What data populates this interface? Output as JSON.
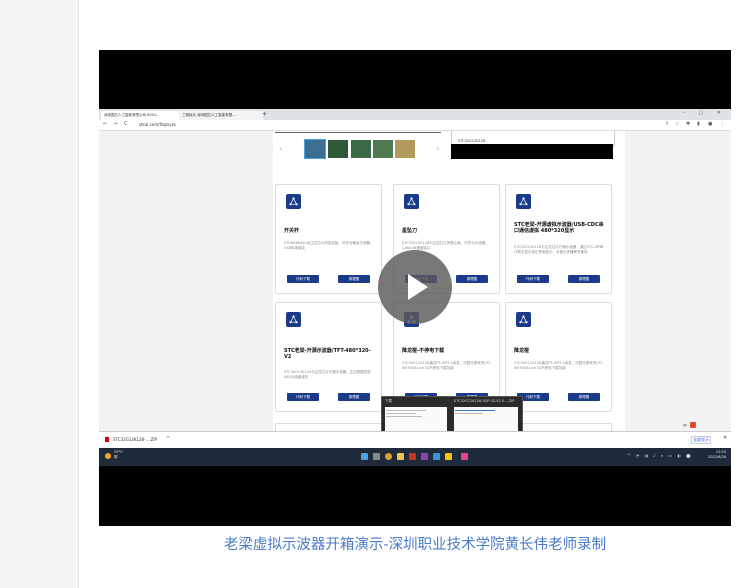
{
  "browser": {
    "tabs": [
      {
        "label": "深圳国芯人工智能有限公司-8051..."
      },
      {
        "label": "三相硅片-深圳国芯人工智能有限..."
      }
    ],
    "new_tab": "+",
    "window_controls": "–  ▢  ✕",
    "address": "stcai.com/fzq/xyzs",
    "nav_back": "←",
    "nav_forward": "→",
    "nav_reload": "C"
  },
  "spec_snippet": "STC32G12K128",
  "cards": [
    {
      "title": "开关杆",
      "desc": "STC8H8K64U为主控芯片的协议板，可作为备用示波器，USB供电稳定",
      "btn1": "代码下载",
      "btn2": "原理图"
    },
    {
      "title": "星坠刀",
      "desc": "STC32G12K128为主控芯片的核心板，可作为示波器，CAN/LIN通信接口",
      "btn1": "代码下载",
      "btn2": "原理图"
    },
    {
      "title": "STC老梁-开源虚拟示波器/USB-CDC串口通信虚拟 480*320显示",
      "desc": "STC32G12K128为主控芯片开源示波器，通过STC-ISP串口助手显示波形界面显示，可做示波器教学使用",
      "btn1": "代码下载",
      "btn2": "原理图"
    },
    {
      "title": "STC老梁-开源示波器/TFT-480*320-V2",
      "desc": "STC32G12K128为主控芯片开源示波器，主控数据控制480示波器波形",
      "btn1": "代码下载",
      "btn2": "原理图"
    },
    {
      "title": "降龙棍-不停电下载",
      "desc": "STC32G12K128通过P3.0/P3.1收发，可替代原来的STC-ISP/USB-Link1D不停电下载功能",
      "btn1": "代码下载",
      "btn2": "原理图"
    },
    {
      "title": "降龙棍",
      "desc": "STC32G12K128通过P3.0/P3.1收发，可替代原来的STC-ISP/USB-Link1D不停电下载功能",
      "btn1": "代码下载",
      "btn2": "原理图"
    }
  ],
  "popup": {
    "left_label": "下载",
    "right_label": "STC32G12K128-SOP-32-V2.0-...ZIP"
  },
  "download_bar": {
    "file": "STC32G12K128-....ZIP",
    "chevron": "^",
    "show_all": "全部显示",
    "close": "✕"
  },
  "taskbar": {
    "weather_temp": "29°C",
    "weather_desc": "阴",
    "time": "12:03",
    "date": "2022/6/26"
  },
  "caption": "老梁虚拟示波器开箱演示-深圳职业技术学院黄长伟老师录制",
  "colors": {
    "accent": "#1a3a8a",
    "caption": "#4a7cc9",
    "taskbar": "#1f2b3a"
  }
}
